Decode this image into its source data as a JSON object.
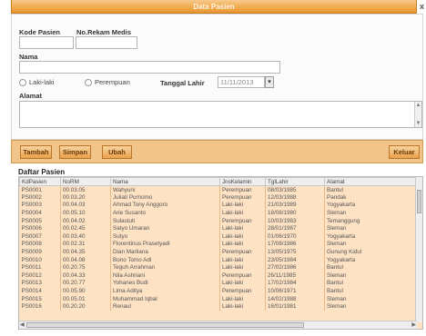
{
  "window": {
    "title": "Data Pasien",
    "close_glyph": "x"
  },
  "form": {
    "kode_label": "Kode Pasien",
    "rekam_label": "No.Rekam Medis",
    "nama_label": "Nama",
    "gender_male": "Laki-laki",
    "gender_female": "Perempuan",
    "tgl_label": "Tanggal Lahir",
    "tgl_value": "11/11/2013",
    "alamat_label": "Alamat"
  },
  "toolbar": {
    "tambah": "Tambah",
    "simpan": "Simpan",
    "ubah": "Ubah",
    "keluar": "Keluar"
  },
  "list": {
    "title": "Daftar Pasien",
    "columns": [
      "KdPasien",
      "NoRM",
      "Nama",
      "JnsKelamin",
      "TglLahir",
      "Alamat"
    ],
    "rows": [
      [
        "PS0001",
        "00.03.05",
        "Wahyuni",
        "Perempuan",
        "08/03/1985",
        "Bantul"
      ],
      [
        "PS0002",
        "00.03.20",
        "Juliati Purnomo",
        "Perempuan",
        "12/03/1988",
        "Pandak"
      ],
      [
        "PS0003",
        "00.04.03",
        "Ahmad Tony Anggoro",
        "Laki-laki",
        "21/03/1989",
        "Yogyakarta"
      ],
      [
        "PS0004",
        "00.05.10",
        "Arie Susanto",
        "Laki-laki",
        "18/08/1980",
        "Sleman"
      ],
      [
        "PS0005",
        "00.04.02",
        "Sulastuti",
        "Perempuan",
        "10/03/1983",
        "Temanggung"
      ],
      [
        "PS0006",
        "00.02.45",
        "Satyo Umaran",
        "Laki-laki",
        "28/01/1987",
        "Sleman"
      ],
      [
        "PS0007",
        "00.03.40",
        "Sutyo",
        "Laki-laki",
        "01/06/1970",
        "Yogyakarta"
      ],
      [
        "PS0008",
        "00.02.31",
        "Florentinus Prasetyadi",
        "Laki-laki",
        "17/08/1986",
        "Sleman"
      ],
      [
        "PS0009",
        "00.04.35",
        "Dian Marliana",
        "Perempuan",
        "13/05/1975",
        "Gunung Kidul"
      ],
      [
        "PS0010",
        "00.04.08",
        "Bono Tomo Adi",
        "Laki-laki",
        "23/05/1984",
        "Yogyakarta"
      ],
      [
        "PS0011",
        "00.20.75",
        "Teguh Arrahman",
        "Laki-laki",
        "27/02/1986",
        "Bantul"
      ],
      [
        "PS0012",
        "00.04.33",
        "Nila Ashriani",
        "Perempuan",
        "26/11/1985",
        "Sleman"
      ],
      [
        "PS0013",
        "00.20.77",
        "Yohanes Budi",
        "Laki-laki",
        "17/02/1984",
        "Bantul"
      ],
      [
        "PS0014",
        "00.05.90",
        "Lima Aditya",
        "Perempuan",
        "10/06/1971",
        "Bantul"
      ],
      [
        "PS0015",
        "00.05.01",
        "Muhammad Iqbal",
        "Laki-laki",
        "14/02/1988",
        "Sleman"
      ],
      [
        "PS0016",
        "00.20.20",
        "Renaul",
        "Laki-laki",
        "16/01/1981",
        "Sleman"
      ]
    ]
  }
}
